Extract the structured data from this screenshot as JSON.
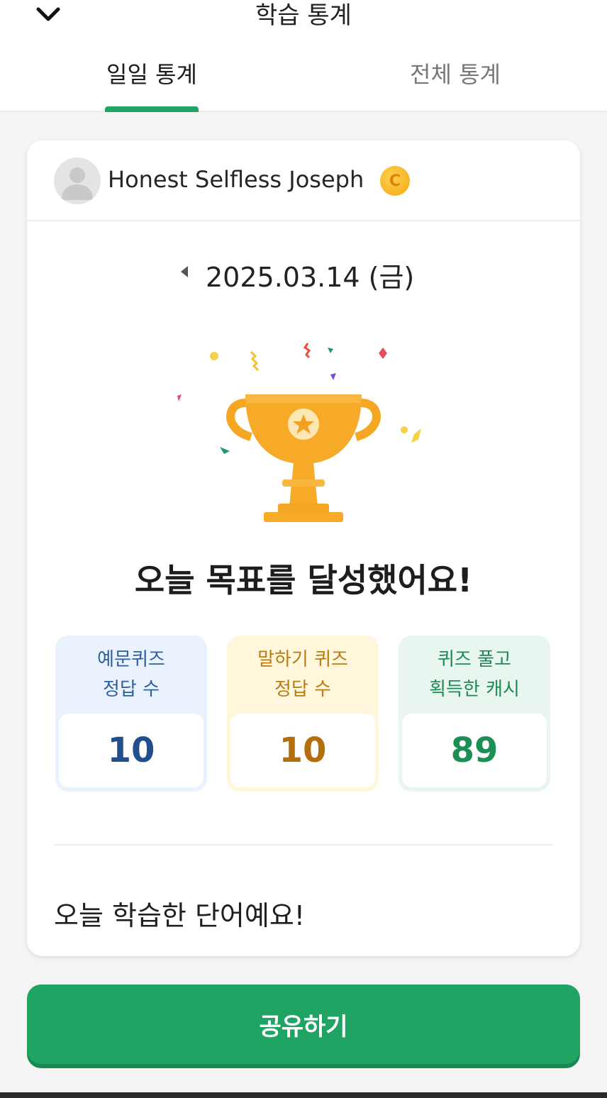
{
  "header": {
    "title": "학습 통계",
    "back_icon": "chevron-down-icon",
    "tabs": [
      {
        "label": "일일 통계",
        "active": true
      },
      {
        "label": "전체 통계",
        "active": false
      }
    ]
  },
  "profile": {
    "name": "Honest Selfless Joseph",
    "badge_icon": "coin-icon",
    "badge_glyph": "C"
  },
  "date": {
    "text": "2025.03.14 (금)",
    "prev_icon": "triangle-left-icon"
  },
  "achievement": {
    "title": "오늘 목표를 달성했어요!"
  },
  "stats": [
    {
      "label_line1": "예문퀴즈",
      "label_line2": "정답 수",
      "value": "10"
    },
    {
      "label_line1": "말하기 퀴즈",
      "label_line2": "정답 수",
      "value": "10"
    },
    {
      "label_line1": "퀴즈 풀고",
      "label_line2": "획득한 캐시",
      "value": "89"
    }
  ],
  "words": {
    "title": "오늘 학습한 단어예요!"
  },
  "share_button": {
    "label": "공유하기"
  },
  "colors": {
    "accent": "#1fa463",
    "trophy": "#f7a928"
  }
}
